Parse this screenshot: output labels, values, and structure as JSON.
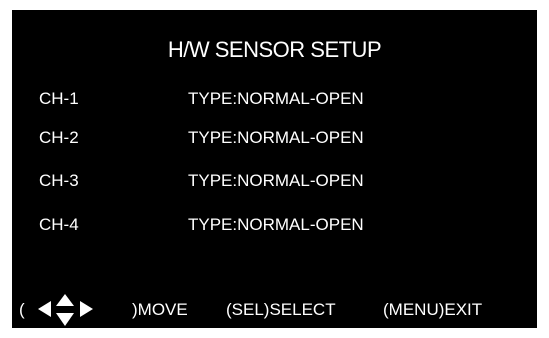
{
  "title": "H/W SENSOR SETUP",
  "channels": [
    {
      "label": "CH-1",
      "type": "TYPE:NORMAL-OPEN"
    },
    {
      "label": "CH-2",
      "type": "TYPE:NORMAL-OPEN"
    },
    {
      "label": "CH-3",
      "type": "TYPE:NORMAL-OPEN"
    },
    {
      "label": "CH-4",
      "type": "TYPE:NORMAL-OPEN"
    }
  ],
  "footer": {
    "open_paren": "(",
    "move_label": ")MOVE",
    "select_label": "(SEL)SELECT",
    "exit_label": "(MENU)EXIT",
    "icons": [
      "arrow-left-icon",
      "arrow-up-icon",
      "arrow-down-icon",
      "arrow-right-icon"
    ]
  },
  "colors": {
    "background": "#000000",
    "text": "#ffffff"
  }
}
